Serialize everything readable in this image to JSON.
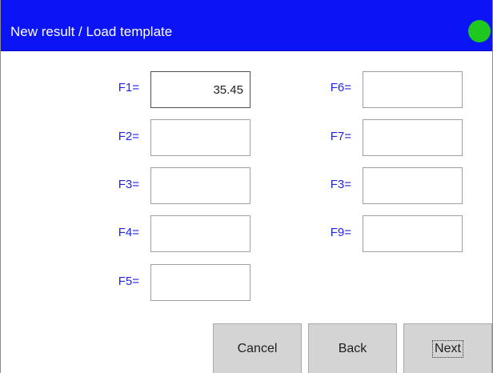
{
  "window": {
    "title": "New result / Load template",
    "titlebar_color": "#0a14f5",
    "status_indicator_color": "#1ec81e"
  },
  "fields": {
    "left": [
      {
        "label": "F1=",
        "value": "35.45"
      },
      {
        "label": "F2=",
        "value": ""
      },
      {
        "label": "F3=",
        "value": ""
      },
      {
        "label": "F4=",
        "value": ""
      },
      {
        "label": "F5=",
        "value": ""
      }
    ],
    "right": [
      {
        "label": "F6=",
        "value": ""
      },
      {
        "label": "F7=",
        "value": ""
      },
      {
        "label": "F3=",
        "value": ""
      },
      {
        "label": "F9=",
        "value": ""
      }
    ]
  },
  "buttons": {
    "cancel": "Cancel",
    "back": "Back",
    "next": "Next"
  },
  "label_color": "#2323e6"
}
